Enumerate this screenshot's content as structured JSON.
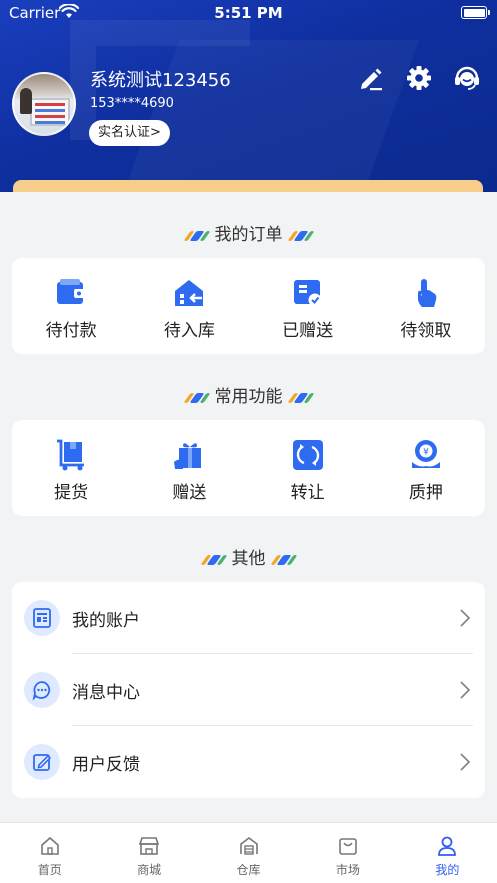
{
  "status_bar": {
    "carrier": "Carrier",
    "time": "5:51 PM"
  },
  "profile": {
    "name": "系统测试123456",
    "phone": "153****4690",
    "verify_label": "实名认证>"
  },
  "orders": {
    "title": "我的订单",
    "items": [
      {
        "label": "待付款",
        "icon": "wallet-icon"
      },
      {
        "label": "待入库",
        "icon": "house-in-icon"
      },
      {
        "label": "已赠送",
        "icon": "gift-card-icon"
      },
      {
        "label": "待领取",
        "icon": "hand-pointer-icon"
      }
    ]
  },
  "functions": {
    "title": "常用功能",
    "items": [
      {
        "label": "提货",
        "icon": "cart-box-icon"
      },
      {
        "label": "赠送",
        "icon": "gift-icon"
      },
      {
        "label": "转让",
        "icon": "transfer-icon"
      },
      {
        "label": "质押",
        "icon": "pledge-coin-icon"
      }
    ]
  },
  "others": {
    "title": "其他",
    "items": [
      {
        "label": "我的账户",
        "icon": "account-card-icon"
      },
      {
        "label": "消息中心",
        "icon": "message-bubble-icon"
      },
      {
        "label": "用户反馈",
        "icon": "feedback-edit-icon"
      }
    ]
  },
  "tabbar": {
    "items": [
      {
        "label": "首页",
        "icon": "home-icon"
      },
      {
        "label": "商城",
        "icon": "store-icon"
      },
      {
        "label": "仓库",
        "icon": "warehouse-icon"
      },
      {
        "label": "市场",
        "icon": "market-bag-icon"
      },
      {
        "label": "我的",
        "icon": "user-icon",
        "active": true
      }
    ]
  },
  "colors": {
    "header": "#0f2f9f",
    "accent": "#2f5ff0",
    "gold": "#f7cd8a",
    "icon_blue": "#2f6bf0"
  }
}
